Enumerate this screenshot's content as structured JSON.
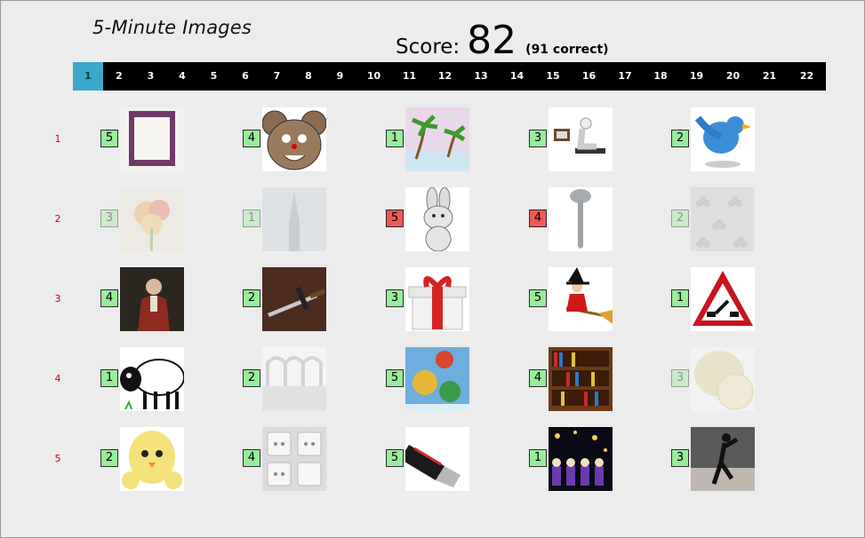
{
  "app": {
    "title": "5-Minute Images"
  },
  "score": {
    "label": "Score:",
    "value": "82",
    "correct": "(91 correct)"
  },
  "tabs": [
    "1",
    "2",
    "3",
    "4",
    "5",
    "6",
    "7",
    "8",
    "9",
    "10",
    "11",
    "12",
    "13",
    "14",
    "15",
    "16",
    "17",
    "18",
    "19",
    "20",
    "21",
    "22"
  ],
  "active_tab": "1",
  "rows": [
    {
      "label": "1",
      "cells": [
        {
          "number": "5",
          "status": "green",
          "image": "picture-frame-icon"
        },
        {
          "number": "4",
          "status": "green",
          "image": "mouse-cartoon-icon"
        },
        {
          "number": "1",
          "status": "green",
          "image": "palm-trees-icon"
        },
        {
          "number": "3",
          "status": "green",
          "image": "tv-watcher-icon"
        },
        {
          "number": "2",
          "status": "green",
          "image": "twitter-bird-icon"
        }
      ]
    },
    {
      "label": "2",
      "cells": [
        {
          "number": "3",
          "status": "faded",
          "image": "flower-icon"
        },
        {
          "number": "1",
          "status": "faded",
          "image": "church-spire-icon"
        },
        {
          "number": "5",
          "status": "red",
          "image": "rabbit-cartoon-icon"
        },
        {
          "number": "4",
          "status": "red",
          "image": "spoon-icon"
        },
        {
          "number": "2",
          "status": "faded",
          "image": "clubs-pattern-icon"
        }
      ]
    },
    {
      "label": "3",
      "cells": [
        {
          "number": "4",
          "status": "green",
          "image": "portrait-painting-icon"
        },
        {
          "number": "2",
          "status": "green",
          "image": "sword-icon"
        },
        {
          "number": "3",
          "status": "green",
          "image": "gift-box-icon"
        },
        {
          "number": "5",
          "status": "green",
          "image": "witch-broom-icon"
        },
        {
          "number": "1",
          "status": "green",
          "image": "drawbridge-sign-icon"
        }
      ]
    },
    {
      "label": "4",
      "cells": [
        {
          "number": "1",
          "status": "green",
          "image": "sheep-cartoon-icon"
        },
        {
          "number": "2",
          "status": "green",
          "image": "arches-icon"
        },
        {
          "number": "5",
          "status": "green",
          "image": "ornaments-icon"
        },
        {
          "number": "4",
          "status": "green",
          "image": "bookshelf-icon"
        },
        {
          "number": "3",
          "status": "faded",
          "image": "lemon-icon"
        }
      ]
    },
    {
      "label": "5",
      "cells": [
        {
          "number": "2",
          "status": "green",
          "image": "chicks-cartoon-icon"
        },
        {
          "number": "4",
          "status": "green",
          "image": "power-outlets-icon"
        },
        {
          "number": "5",
          "status": "green",
          "image": "usb-drive-icon"
        },
        {
          "number": "1",
          "status": "green",
          "image": "night-stars-icon"
        },
        {
          "number": "3",
          "status": "green",
          "image": "dancer-silhouette-icon"
        }
      ]
    }
  ],
  "colors": {
    "correct": "#98ec9c",
    "wrong": "#f05858",
    "row_label": "#d40000",
    "tab_active": "#3aa9c9",
    "tab_bar": "#000000"
  }
}
